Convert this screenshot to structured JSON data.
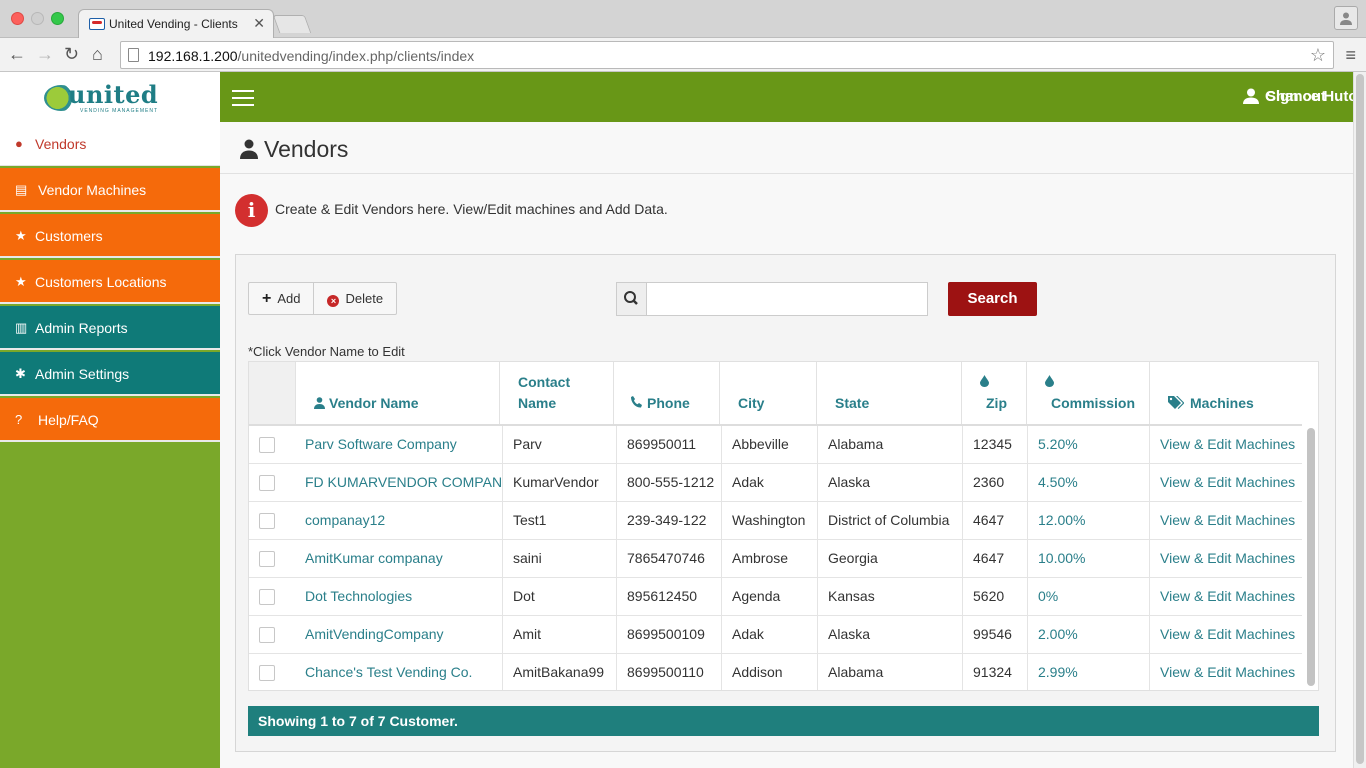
{
  "browser": {
    "tab_title": "United Vending - Clients",
    "tab_close": "✕",
    "url_host": "192.168.1.200",
    "url_path": "/unitedvending/index.php/clients/index",
    "nav_back": "←",
    "nav_forward": "→",
    "nav_reload": "↻",
    "nav_home": "⌂",
    "star": "☆",
    "menu": "≡"
  },
  "logo": {
    "text": "united",
    "sub": "VENDING MANAGEMENT"
  },
  "sidebar": {
    "items": [
      {
        "label": "Vendors",
        "icon": "user-icon",
        "glyph": "●",
        "style": "active"
      },
      {
        "label": "Vendor Machines",
        "icon": "building-icon",
        "glyph": "▤",
        "style": "orange"
      },
      {
        "label": "Customers",
        "icon": "star-icon",
        "glyph": "★",
        "style": "orange"
      },
      {
        "label": "Customers Locations",
        "icon": "star-icon",
        "glyph": "★",
        "style": "orange"
      },
      {
        "label": "Admin Reports",
        "icon": "bar-chart-icon",
        "glyph": "▥",
        "style": "teal"
      },
      {
        "label": "Admin Settings",
        "icon": "gear-icon",
        "glyph": "✱",
        "style": "teal"
      },
      {
        "label": "Help/FAQ",
        "icon": "question-icon",
        "glyph": "?",
        "style": "orange"
      }
    ]
  },
  "topbar": {
    "user_name": "Chance Hutchison",
    "sign_out": "Sign out"
  },
  "page": {
    "title": "Vendors",
    "info_text": "Create & Edit Vendors here. View/Edit machines and Add Data.",
    "info_glyph": "i"
  },
  "actions": {
    "add_label": "Add",
    "add_glyph": "+",
    "delete_label": "Delete",
    "delete_glyph": "×",
    "search_button": "Search",
    "search_value": ""
  },
  "hint": "*Click Vendor Name to Edit",
  "table": {
    "columns": [
      {
        "label": "Vendor Name",
        "icon": "user-icon"
      },
      {
        "label": "Contact Name",
        "icon": ""
      },
      {
        "label": "Phone",
        "icon": "phone-icon"
      },
      {
        "label": "City",
        "icon": ""
      },
      {
        "label": "State",
        "icon": ""
      },
      {
        "label": "Zip",
        "icon": "drop-icon"
      },
      {
        "label": "Commission",
        "icon": "drop-icon"
      },
      {
        "label": "Machines",
        "icon": "tags-icon"
      }
    ],
    "rows": [
      {
        "vendor": "Parv Software Company",
        "contact": "Parv",
        "phone": "869950011",
        "city": "Abbeville",
        "state": "Alabama",
        "zip": "12345",
        "commission": "5.20%",
        "machines": "View & Edit Machines"
      },
      {
        "vendor": "FD KUMARVENDOR COMPANY",
        "contact": "KumarVendor",
        "phone": "800-555-1212",
        "city": "Adak",
        "state": "Alaska",
        "zip": "2360",
        "commission": "4.50%",
        "machines": "View & Edit Machines"
      },
      {
        "vendor": "companay12",
        "contact": "Test1",
        "phone": "239-349-122",
        "city": "Washington",
        "state": "District of Columbia",
        "zip": "4647",
        "commission": "12.00%",
        "machines": "View & Edit Machines"
      },
      {
        "vendor": "AmitKumar companay",
        "contact": "saini",
        "phone": "7865470746",
        "city": "Ambrose",
        "state": "Georgia",
        "zip": "4647",
        "commission": "10.00%",
        "machines": "View & Edit Machines"
      },
      {
        "vendor": "Dot Technologies",
        "contact": "Dot",
        "phone": "895612450",
        "city": "Agenda",
        "state": "Kansas",
        "zip": "5620",
        "commission": "0%",
        "machines": "View & Edit Machines"
      },
      {
        "vendor": "AmitVendingCompany",
        "contact": "Amit",
        "phone": "8699500109",
        "city": "Adak",
        "state": "Alaska",
        "zip": "99546",
        "commission": "2.00%",
        "machines": "View & Edit Machines"
      },
      {
        "vendor": "Chance's Test Vending Co.",
        "contact": "AmitBakana99",
        "phone": "8699500110",
        "city": "Addison",
        "state": "Alabama",
        "zip": "91324",
        "commission": "2.99%",
        "machines": "View & Edit Machines"
      }
    ]
  },
  "footer": "Showing 1 to 7 of 7 Customer.",
  "colors": {
    "topbar": "#689717",
    "sidebar_bg": "#7aa82a",
    "orange_item": "#f56a0b",
    "teal_item": "#0f7a78",
    "link": "#2a7f8a",
    "search_button": "#9d1212",
    "footer": "#1f7f7d"
  }
}
